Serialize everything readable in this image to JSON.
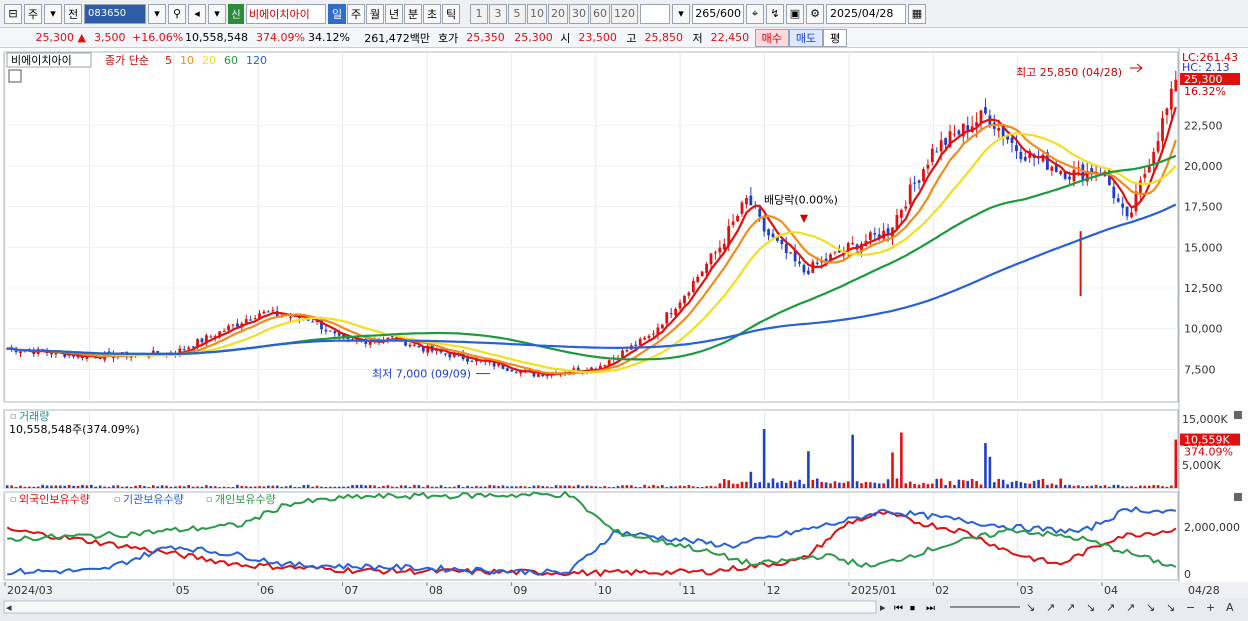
{
  "toolbar": {
    "mode": "주",
    "prev": "전",
    "code": "083650",
    "name": "비에이치아이",
    "sin_badge": "신",
    "periods": [
      "일",
      "주",
      "월",
      "년",
      "분",
      "초",
      "틱"
    ],
    "selected_period": "일",
    "intervals": [
      "1",
      "3",
      "5",
      "10",
      "20",
      "30",
      "60",
      "120"
    ],
    "count": "265/600",
    "date": "2025/04/28",
    "icons": [
      "window-icon",
      "dropdown-icon",
      "search-icon",
      "speaker-icon",
      "crosshair-icon",
      "draw-icon",
      "save-icon",
      "settings-icon",
      "calendar-icon"
    ]
  },
  "quote": {
    "price": "25,300",
    "arrow": "▲",
    "change": "3,500",
    "change_pct": "+16.06%",
    "volume": "10,558,548",
    "volume_ratio": "374.09%",
    "turnover": "34.12%",
    "amount": "261,472백만",
    "ask_label": "호가",
    "ask1": "25,350",
    "ask2": "25,300",
    "open_label": "시",
    "open": "23,500",
    "high_label": "고",
    "high": "25,850",
    "low_label": "저",
    "low": "22,450",
    "buy": "매수",
    "sell": "매도",
    "avg": "평"
  },
  "price_panel": {
    "legend_name": "비에이치아이",
    "legend_ma": "종가 단순",
    "ma_periods": [
      "5",
      "10",
      "20",
      "60",
      "120"
    ],
    "ma_colors": [
      "#e01010",
      "#f08c1c",
      "#f0e020",
      "#1c9a3c",
      "#2860d8"
    ],
    "yticks": [
      "22,500",
      "20,000",
      "17,500",
      "15,000",
      "12,500",
      "10,000",
      "7,500"
    ],
    "lc_label": "LC:261.43",
    "hc_label": "HC: 2.13",
    "price_tag": "25,300",
    "pct_tag": "16.32%",
    "high_annot": "최고 25,850 (04/28)",
    "low_annot": "최저 7,000 (09/09)",
    "div_annot": "배당락(0.00%)"
  },
  "volume_panel": {
    "title": "거래량",
    "info": "10,558,548주(374.09%)",
    "yticks": [
      "15,000K",
      "10,000K",
      "5,000K"
    ],
    "tag": "10,559K",
    "tag_pct": "374.09%"
  },
  "holding_panel": {
    "series": [
      "외국인보유수량",
      "기관보유수량",
      "개인보유수량"
    ],
    "colors": [
      "#e01010",
      "#2860d8",
      "#2a9a4a"
    ],
    "yticks": [
      "2,000,000",
      "0"
    ]
  },
  "xaxis": [
    "2024/03",
    "05",
    "06",
    "07",
    "08",
    "09",
    "10",
    "11",
    "12",
    "2025/01",
    "02",
    "03",
    "04",
    "04/28"
  ],
  "chart_data": {
    "type": "candlestick",
    "x_range": [
      "2024/03",
      "2025/04/28"
    ],
    "ylim_price": [
      5500,
      27000
    ],
    "close_points": [
      {
        "date": "2024/03",
        "value": 8800
      },
      {
        "date": "2024/04",
        "value": 8300
      },
      {
        "date": "2024/05",
        "value": 8500
      },
      {
        "date": "2024/05/20",
        "value": 10000
      },
      {
        "date": "2024/06",
        "value": 11000
      },
      {
        "date": "2024/06/20",
        "value": 10600
      },
      {
        "date": "2024/07",
        "value": 9200
      },
      {
        "date": "2024/07/20",
        "value": 9400
      },
      {
        "date": "2024/08",
        "value": 8700
      },
      {
        "date": "2024/08/20",
        "value": 8000
      },
      {
        "date": "2024/09/09",
        "value": 7200
      },
      {
        "date": "2024/10",
        "value": 7600
      },
      {
        "date": "2024/10/20",
        "value": 9500
      },
      {
        "date": "2024/11",
        "value": 11800
      },
      {
        "date": "2024/11/15",
        "value": 15000
      },
      {
        "date": "2024/11/25",
        "value": 18000
      },
      {
        "date": "2024/12",
        "value": 16000
      },
      {
        "date": "2024/12/15",
        "value": 13500
      },
      {
        "date": "2025/01",
        "value": 15000
      },
      {
        "date": "2025/01/15",
        "value": 16000
      },
      {
        "date": "2025/02",
        "value": 21000
      },
      {
        "date": "2025/02/20",
        "value": 23200
      },
      {
        "date": "2025/03",
        "value": 21000
      },
      {
        "date": "2025/03/20",
        "value": 19500
      },
      {
        "date": "2025/04",
        "value": 19800
      },
      {
        "date": "2025/04/10",
        "value": 16500
      },
      {
        "date": "2025/04/20",
        "value": 21500
      },
      {
        "date": "2025/04/28",
        "value": 25300
      }
    ],
    "extremes": {
      "high": 25850,
      "high_date": "04/28",
      "low": 7000,
      "low_date": "09/09"
    },
    "last_volume": 10558548
  }
}
